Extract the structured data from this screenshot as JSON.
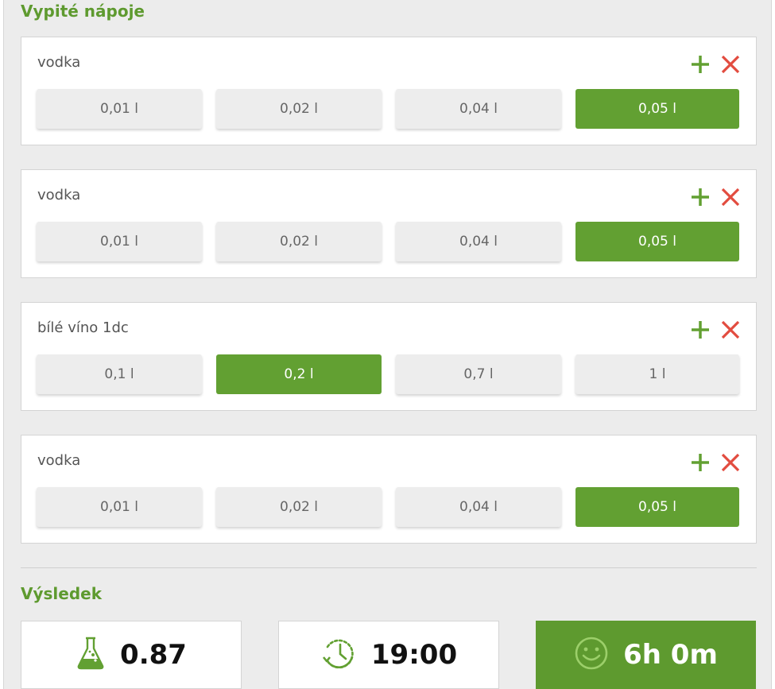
{
  "drinks_title": "Vypité nápoje",
  "result_title": "Výsledek",
  "colors": {
    "accent": "#62a032",
    "remove": "#e24c3f"
  },
  "drinks": [
    {
      "name": "vodka",
      "options": [
        "0,01 l",
        "0,02 l",
        "0,04 l",
        "0,05 l"
      ],
      "selected": 3
    },
    {
      "name": "vodka",
      "options": [
        "0,01 l",
        "0,02 l",
        "0,04 l",
        "0,05 l"
      ],
      "selected": 3
    },
    {
      "name": "bílé víno 1dc",
      "options": [
        "0,1 l",
        "0,2 l",
        "0,7 l",
        "1 l"
      ],
      "selected": 1
    },
    {
      "name": "vodka",
      "options": [
        "0,01 l",
        "0,02 l",
        "0,04 l",
        "0,05 l"
      ],
      "selected": 3
    }
  ],
  "result": {
    "alcohol": {
      "icon": "flask-icon",
      "value": "0.87"
    },
    "time": {
      "icon": "clock-icon",
      "value": "19:00"
    },
    "sober": {
      "icon": "smiley-icon",
      "value": "6h 0m"
    }
  }
}
